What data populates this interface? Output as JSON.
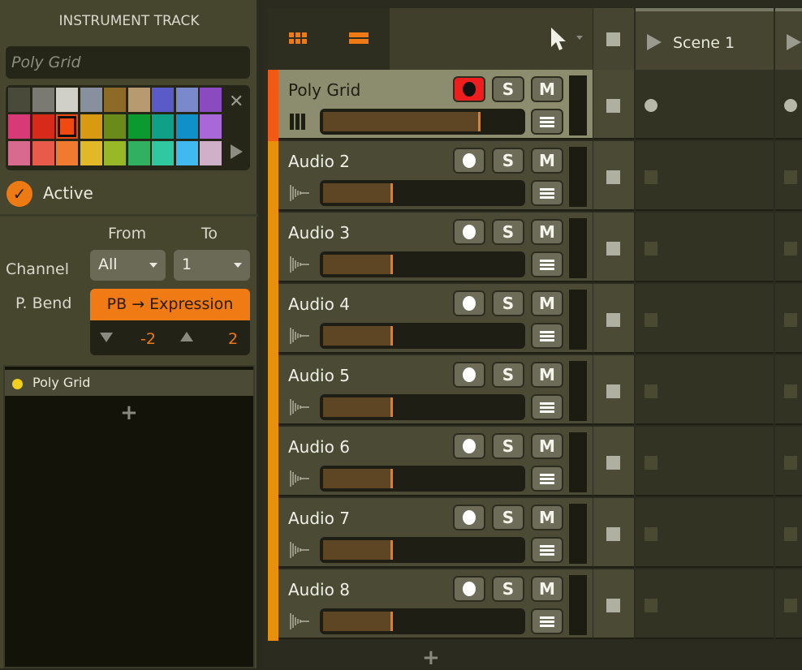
{
  "inspector": {
    "title": "INSTRUMENT TRACK",
    "track_name_placeholder": "Poly Grid",
    "palette": {
      "colors": [
        "#4a4a3a",
        "#7a7a72",
        "#d0d0c8",
        "#8890a0",
        "#8e6a28",
        "#b89a70",
        "#5a5ac8",
        "#7a88cc",
        "#8a4ac0",
        "#d83a78",
        "#d82a1a",
        "#f04a10",
        "#d89a10",
        "#6a8a1a",
        "#0a9a30",
        "#10a088",
        "#1090c8",
        "#a868d8",
        "#d86a90",
        "#e85a4a",
        "#f07a30",
        "#e0b828",
        "#98b828",
        "#30b060",
        "#30c8a0",
        "#40b8f0",
        "#d0b0c8"
      ],
      "selected_index": 11
    },
    "active_label": "Active",
    "active": true,
    "from_label": "From",
    "to_label": "To",
    "channel_label": "Channel",
    "channel_from": "All",
    "channel_to": "1",
    "pbend_label": "P. Bend",
    "pb_button": "PB → Expression",
    "pb_down": "-2",
    "pb_up": "2",
    "devices": [
      {
        "name": "Poly Grid",
        "color": "#f2cf1a"
      }
    ],
    "add_device": "+"
  },
  "header": {
    "tool": "pointer-tool",
    "scenes": [
      "Scene 1"
    ]
  },
  "tracks": [
    {
      "name": "Poly Grid",
      "type": "instrument",
      "color": "#f05a14",
      "armed": true,
      "volume": 0.79,
      "selected": true
    },
    {
      "name": "Audio 2",
      "type": "audio",
      "color": "#e8900c",
      "armed": false,
      "volume": 0.35
    },
    {
      "name": "Audio 3",
      "type": "audio",
      "color": "#e8900c",
      "armed": false,
      "volume": 0.35
    },
    {
      "name": "Audio 4",
      "type": "audio",
      "color": "#e8900c",
      "armed": false,
      "volume": 0.35
    },
    {
      "name": "Audio 5",
      "type": "audio",
      "color": "#e8900c",
      "armed": false,
      "volume": 0.35
    },
    {
      "name": "Audio 6",
      "type": "audio",
      "color": "#e8900c",
      "armed": false,
      "volume": 0.35
    },
    {
      "name": "Audio 7",
      "type": "audio",
      "color": "#e8900c",
      "armed": false,
      "volume": 0.35
    },
    {
      "name": "Audio 8",
      "type": "audio",
      "color": "#e8900c",
      "armed": false,
      "volume": 0.35
    }
  ],
  "labels": {
    "solo": "S",
    "mute": "M",
    "add_track": "+"
  }
}
